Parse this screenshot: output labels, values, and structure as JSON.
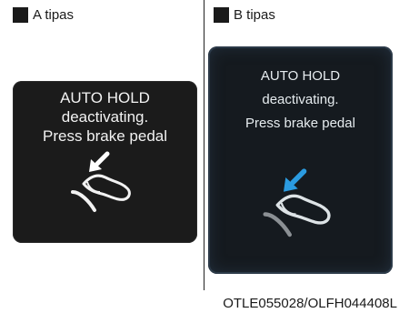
{
  "panel_a": {
    "heading": "A tipas",
    "message_lines": [
      "AUTO HOLD",
      "deactivating.",
      "Press brake pedal"
    ],
    "arrow_color": "#ffffff",
    "icon": "brake-pedal-icon"
  },
  "panel_b": {
    "heading": "B tipas",
    "message_lines": [
      "AUTO HOLD",
      "deactivating.",
      "Press brake pedal"
    ],
    "arrow_color": "#2b9be0",
    "icon": "brake-pedal-icon"
  },
  "figure_code": "OTLE055028/OLFH044408L"
}
